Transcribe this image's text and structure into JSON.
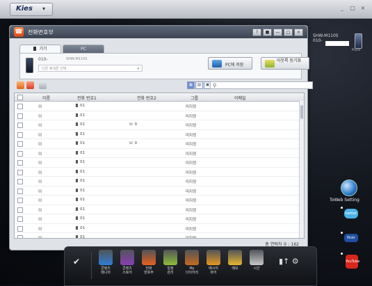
{
  "app": {
    "name": "Kies",
    "window_controls": [
      "_",
      "□",
      "×"
    ]
  },
  "phonebook": {
    "title": "전화번호부",
    "title_controls": [
      "?",
      "■",
      "—",
      "□",
      "×"
    ],
    "tabs": [
      {
        "label": "기기"
      },
      {
        "label": "PC"
      }
    ],
    "device": {
      "number": "010-",
      "model": "SHW-M110S",
      "select_placeholder": "다른 휴대폰 선택"
    },
    "buttons": {
      "save_to_pc": "PC에 저장",
      "outlook_sync": "아웃룩 동기화"
    },
    "view_buttons": [
      "▦",
      "▤",
      "▣"
    ],
    "search_placeholder": "",
    "columns": [
      "이름",
      "전화 번호1",
      "전화 번호2",
      "그룹",
      "이메일"
    ],
    "rows": [
      {
        "name": "이",
        "phone1": "01",
        "phone2": "",
        "group": "미지정",
        "email": ""
      },
      {
        "name": "이",
        "phone1": "01",
        "phone2": "",
        "group": "미지정",
        "email": ""
      },
      {
        "name": "이",
        "phone1": "01",
        "phone2": "0",
        "group": "미지정",
        "email": ""
      },
      {
        "name": "이",
        "phone1": "01",
        "phone2": "",
        "group": "미지정",
        "email": ""
      },
      {
        "name": "이",
        "phone1": "01",
        "phone2": "0",
        "group": "미지정",
        "email": ""
      },
      {
        "name": "이",
        "phone1": "01",
        "phone2": "",
        "group": "미지정",
        "email": ""
      },
      {
        "name": "이",
        "phone1": "01",
        "phone2": "",
        "group": "미지정",
        "email": ""
      },
      {
        "name": "이",
        "phone1": "01",
        "phone2": "",
        "group": "미지정",
        "email": ""
      },
      {
        "name": "이",
        "phone1": "01",
        "phone2": "",
        "group": "미지정",
        "email": ""
      },
      {
        "name": "이",
        "phone1": "01",
        "phone2": "",
        "group": "미지정",
        "email": ""
      },
      {
        "name": "이",
        "phone1": "01",
        "phone2": "",
        "group": "미지정",
        "email": ""
      },
      {
        "name": "이",
        "phone1": "01",
        "phone2": "",
        "group": "미지정",
        "email": ""
      },
      {
        "name": "이",
        "phone1": "01",
        "phone2": "",
        "group": "미지정",
        "email": ""
      },
      {
        "name": "이",
        "phone1": "01",
        "phone2": "",
        "group": "미지정",
        "email": ""
      },
      {
        "name": "이",
        "phone1": "01",
        "phone2": "",
        "group": "미지정",
        "email": ""
      },
      {
        "name": "이",
        "phone1": "01",
        "phone2": "",
        "group": "미지정",
        "email": ""
      }
    ],
    "total_label": "총 연락처 수 : 162"
  },
  "device_panel": {
    "model": "SHW-M110S",
    "number": "010-",
    "phone_label": "Phone"
  },
  "widgets": {
    "toweb_label": "ToWeb Setting",
    "twitter_label": "twitter",
    "flickr_label": "flickr",
    "youtube_label": "YouTube"
  },
  "dock": {
    "items": [
      {
        "label": "콘텐츠\n매니저",
        "icon": "content-manager-icon",
        "color": "#2f7fd4"
      },
      {
        "label": "콘텐츠\n스토어",
        "icon": "content-store-icon",
        "color": "#8b3fb8"
      },
      {
        "label": "전화\n번호부",
        "icon": "phonebook-icon",
        "color": "#e8611f"
      },
      {
        "label": "일정\n관리",
        "icon": "calendar-icon",
        "color": "#8fbf3a"
      },
      {
        "label": "My\n다이어리",
        "icon": "diary-icon",
        "color": "#c86b1e"
      },
      {
        "label": "메시지\n뷰어",
        "icon": "message-viewer-icon",
        "color": "#e89a20"
      },
      {
        "label": "메모",
        "icon": "memo-icon",
        "color": "#e8b730"
      },
      {
        "label": "시간",
        "icon": "clock-icon",
        "color": "#c8c8c8"
      }
    ]
  }
}
